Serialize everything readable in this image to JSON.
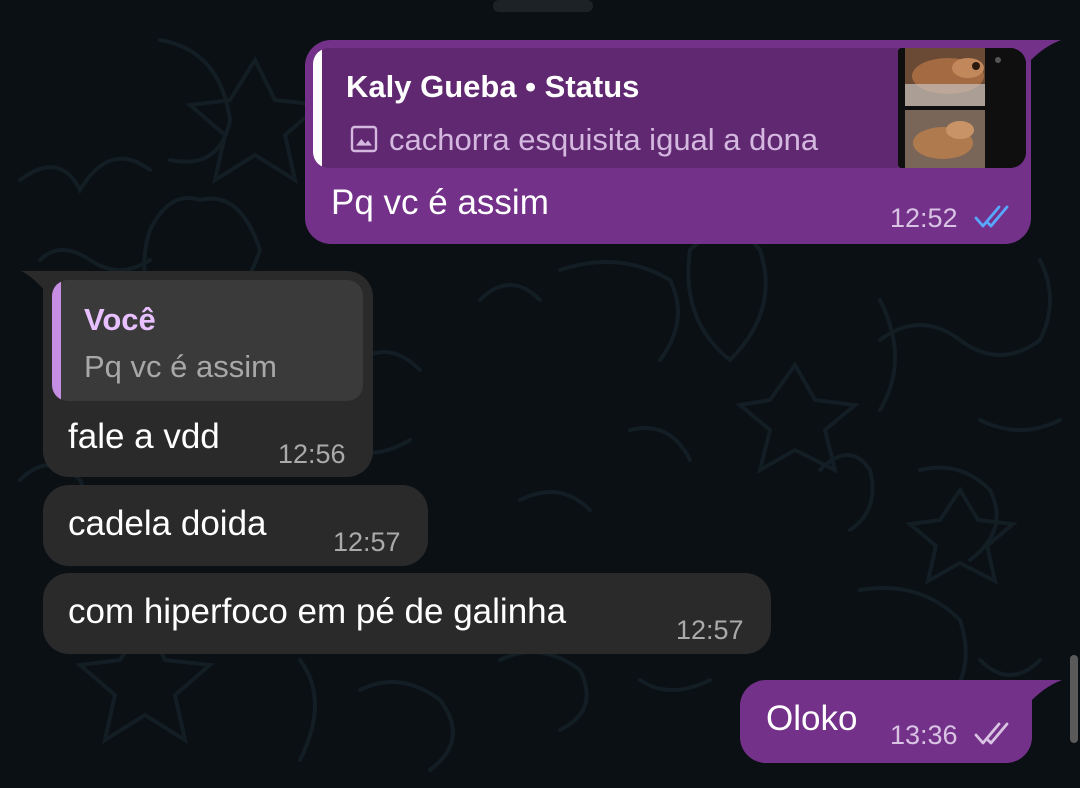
{
  "colors": {
    "outgoing_bubble": "#74318a",
    "incoming_bubble": "#2a2a2b",
    "quote_bar_out": "#ffffff",
    "quote_bar_in": "#c58ee3",
    "read_ticks": "#57a9ff",
    "delivered_ticks": "#d9c3e3"
  },
  "messages": [
    {
      "direction": "outgoing",
      "reply": {
        "author": "Kaly Gueba • Status",
        "icon": "image-icon",
        "text": "cachorra esquisita igual a dona",
        "has_thumbnail": true
      },
      "text": "Pq vc é assim",
      "time": "12:52",
      "status": "read"
    },
    {
      "direction": "incoming",
      "reply": {
        "author": "Você",
        "text": "Pq vc é assim"
      },
      "text": "fale a vdd",
      "time": "12:56"
    },
    {
      "direction": "incoming",
      "text": "cadela doida",
      "time": "12:57"
    },
    {
      "direction": "incoming",
      "text": "com hiperfoco em pé de galinha",
      "time": "12:57"
    },
    {
      "direction": "outgoing",
      "text": "Oloko",
      "time": "13:36",
      "status": "delivered"
    }
  ]
}
